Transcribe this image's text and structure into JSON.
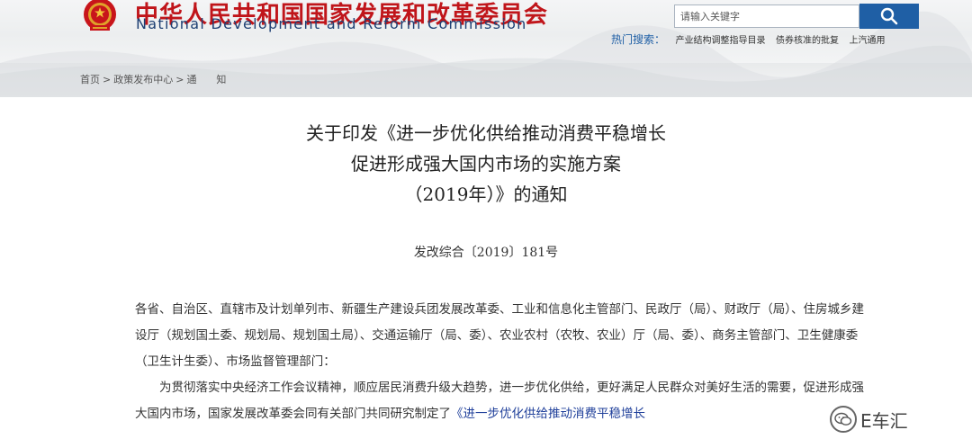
{
  "site": {
    "title_cn": "中华人民共和国国家发展和改革委员会",
    "title_en": "National Development and Reform Commission",
    "emblem_icon": "national-emblem-icon"
  },
  "search": {
    "placeholder": "请输入关键字",
    "button_icon": "search-icon",
    "hot_label": "热门搜索：",
    "hot_items": [
      "产业结构调整指导目录",
      "债券核准的批复",
      "上汽通用"
    ]
  },
  "breadcrumb": {
    "items": [
      "首页",
      "政策发布中心",
      "通　　知"
    ],
    "separator": ">"
  },
  "document": {
    "title_lines": [
      "关于印发《进一步优化供给推动消费平稳增长",
      "促进形成强大国内市场的实施方案",
      "（2019年）》的通知"
    ],
    "doc_number": "发改综合〔2019〕181号",
    "addressee": "各省、自治区、直辖市及计划单列市、新疆生产建设兵团发展改革委、工业和信息化主管部门、民政厅（局）、财政厅（局）、住房城乡建设厅（规划国土委、规划局、规划国土局）、交通运输厅（局、委）、农业农村（农牧、农业）厅（局、委）、商务主管部门、卫生健康委（卫生计生委）、市场监督管理部门：",
    "para1_text": "为贯彻落实中央经济工作会议精神，顺应居民消费升级大趋势，进一步优化供给，更好满足人民群众对美好生活的需要，促进形成强大国内市场，国家发展改革委会同有关部门共同研究制定了",
    "para1_link": "《进一步优化供给推动消费平稳增长"
  },
  "watermark": {
    "text": "E车汇",
    "icon": "wechat-icon"
  },
  "colors": {
    "brand_red": "#c0151a",
    "brand_blue": "#1d3f73",
    "search_button": "#1f5fa5",
    "link": "#1f3f9a"
  }
}
